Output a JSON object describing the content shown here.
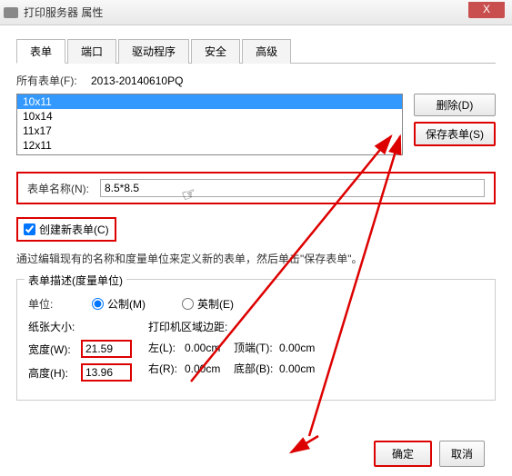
{
  "window": {
    "title": "打印服务器 属性",
    "close": "X"
  },
  "tabs": [
    "表单",
    "端口",
    "驱动程序",
    "安全",
    "高级"
  ],
  "allFormsLabel": "所有表单(F):",
  "allFormsValue": "2013-20140610PQ",
  "listItems": [
    "10x11",
    "10x14",
    "11x17",
    "12x11"
  ],
  "selectedIndex": 0,
  "buttons": {
    "delete": "删除(D)",
    "save": "保存表单(S)",
    "ok": "确定",
    "cancel": "取消"
  },
  "formNameLabel": "表单名称(N):",
  "formNameValue": "8.5*8.5",
  "createNewLabel": "创建新表单(C)",
  "description": "通过编辑现有的名称和度量单位来定义新的表单，然后单击\"保存表单\"。",
  "descTitle": "表单描述(度量单位)",
  "unitsLabel": "单位:",
  "units": {
    "metric": "公制(M)",
    "imperial": "英制(E)"
  },
  "paperSizeLabel": "纸张大小:",
  "marginLabel": "打印机区域边距:",
  "dims": {
    "widthLabel": "宽度(W):",
    "widthValue": "21.59",
    "heightLabel": "高度(H):",
    "heightValue": "13.96",
    "leftLabel": "左(L):",
    "leftValue": "0.00cm",
    "rightLabel": "右(R):",
    "rightValue": "0.00cm",
    "topLabel": "顶端(T):",
    "topValue": "0.00cm",
    "bottomLabel": "底部(B):",
    "bottomValue": "0.00cm"
  }
}
